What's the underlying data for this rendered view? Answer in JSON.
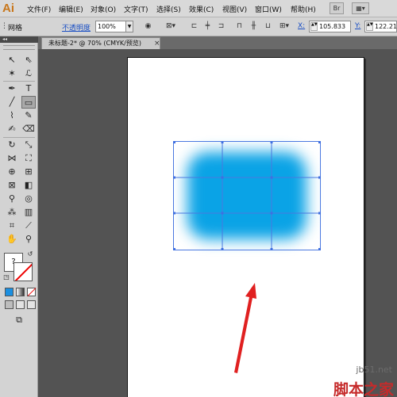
{
  "app": {
    "logo": "Ai"
  },
  "menubar": {
    "items": [
      "文件(F)",
      "编辑(E)",
      "对象(O)",
      "文字(T)",
      "选择(S)",
      "效果(C)",
      "视图(V)",
      "窗口(W)",
      "帮助(H)"
    ],
    "bridge_button": "Br",
    "arrange_button": "▦▾"
  },
  "controlbar": {
    "selection_label": "网格",
    "opacity_label": "不透明度",
    "opacity_value": "100%",
    "x_label": "X:",
    "x_value": "105.833",
    "y_label": "Y:",
    "y_value": "122.21"
  },
  "document": {
    "tab_title": "未标题-2* @ 70% (CMYK/预览)",
    "close_glyph": "×"
  },
  "toolbox": {
    "grip": "◂◂",
    "fill_glyph": "?"
  },
  "canvas": {
    "mesh_color": "#0aa3e6",
    "mesh_line_color": "#4a78e0",
    "arrow_color": "#e02020"
  },
  "watermark": {
    "site": "jb51.net",
    "brand": "脚本之家"
  }
}
